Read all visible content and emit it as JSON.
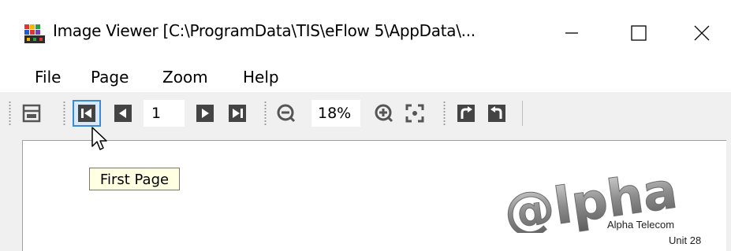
{
  "window": {
    "title": "Image Viewer [C:\\ProgramData\\TIS\\eFlow 5\\AppData\\...",
    "app_icon": "colored-grid-icon",
    "controls": [
      "minimize-icon",
      "maximize-icon",
      "close-icon"
    ]
  },
  "menu": {
    "items": [
      "File",
      "Page",
      "Zoom",
      "Help"
    ]
  },
  "toolbar": {
    "page_number": "1",
    "zoom_level": "18%",
    "icons": [
      "print-icon",
      "first-page-icon",
      "previous-page-icon",
      "next-page-icon",
      "last-page-icon",
      "zoom-out-icon",
      "zoom-in-icon",
      "fit-page-icon",
      "rotate-right-icon",
      "rotate-left-icon"
    ]
  },
  "tooltip": {
    "text": "First Page"
  },
  "document": {
    "logo_text": "@lpha",
    "company_name": "Alpha Telecom",
    "address_line": "Unit 28"
  },
  "colors": {
    "highlight_border": "#3c8ad1",
    "highlight_fill": "#d7e9fa",
    "tooltip_bg": "#ffffe1"
  }
}
